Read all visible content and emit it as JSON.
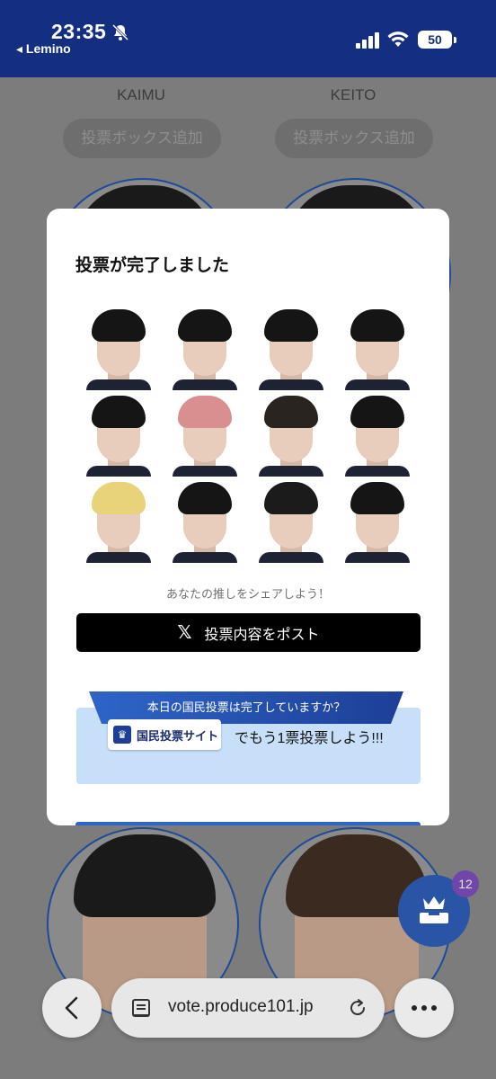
{
  "status_bar": {
    "time": "23:35",
    "back_app": "◂ Lemino",
    "battery": "50",
    "icons": [
      "bell-muted-icon",
      "signal-icon",
      "wifi-icon",
      "battery-icon"
    ]
  },
  "background": {
    "contestants": [
      {
        "name": "KAIMU",
        "vote_box_label": "投票ボックス追加"
      },
      {
        "name": "KEITO",
        "vote_box_label": "投票ボックス追加"
      }
    ]
  },
  "modal": {
    "title": "投票が完了しました",
    "photos": [
      {
        "hair_color": "#151515"
      },
      {
        "hair_color": "#151515"
      },
      {
        "hair_color": "#151515"
      },
      {
        "hair_color": "#151515"
      },
      {
        "hair_color": "#151515"
      },
      {
        "hair_color": "#d98f8f"
      },
      {
        "hair_color": "#2a2420"
      },
      {
        "hair_color": "#151515"
      },
      {
        "hair_color": "#e8d27a"
      },
      {
        "hair_color": "#151515"
      },
      {
        "hair_color": "#1b1b1b"
      },
      {
        "hair_color": "#151515"
      }
    ],
    "share_hint": "あなたの推しをシェアしよう！",
    "post_button_label": "投票内容をポスト",
    "post_icon": "x-logo-icon",
    "banner": {
      "header": "本日の国民投票は完了していますか？",
      "site_badge": "国民投票サイト",
      "cta": "でもう1票投票しよう!!!"
    }
  },
  "fab": {
    "count": "12",
    "icon": "crown-ballot-icon"
  },
  "browser": {
    "url": "vote.produce101.jp",
    "icons": [
      "back-icon",
      "reader-icon",
      "reload-icon",
      "more-icon"
    ]
  },
  "colors": {
    "status_bar_bg": "#142e82",
    "accent": "#2e65c8",
    "fab": "#2a55a6",
    "badge": "#7046a8"
  }
}
